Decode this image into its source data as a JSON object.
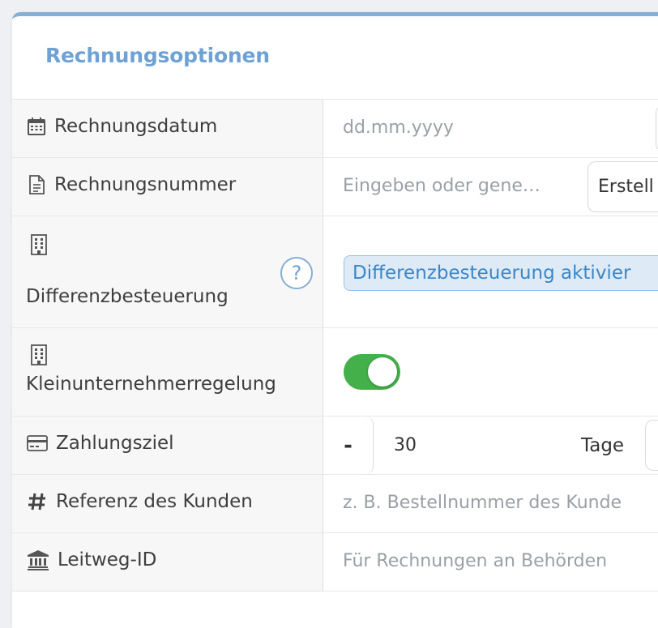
{
  "card": {
    "title": "Rechnungsoptionen"
  },
  "rows": {
    "date": {
      "icon": "calendar-icon",
      "label": "Rechnungsdatum",
      "placeholder": "dd.mm.yyyy"
    },
    "number": {
      "icon": "document-icon",
      "label": "Rechnungsnummer",
      "placeholder": "Eingeben oder gene…",
      "button_label": "Erstell"
    },
    "margin_tax": {
      "icon": "building-icon",
      "label": "Differenzbesteuerung",
      "help": "?",
      "badge_label": "Differenzbesteuerung aktivier"
    },
    "small_business": {
      "icon": "building-icon",
      "label": "Kleinunternehmerregelung",
      "toggle_on": true
    },
    "payment_term": {
      "icon": "credit-card-icon",
      "label": "Zahlungsziel",
      "minus": "-",
      "value": "30",
      "unit": "Tage"
    },
    "customer_ref": {
      "icon": "hash-icon",
      "label": "Referenz des Kunden",
      "placeholder": "z. B. Bestellnummer des Kunde"
    },
    "route_id": {
      "icon": "bank-icon",
      "label": "Leitweg-ID",
      "placeholder": "Für Rechnungen an Behörden"
    }
  },
  "colors": {
    "accent": "#6fa2d3",
    "toggle_on": "#43b049",
    "badge_bg": "#deebf6",
    "badge_text": "#3b86c7"
  }
}
